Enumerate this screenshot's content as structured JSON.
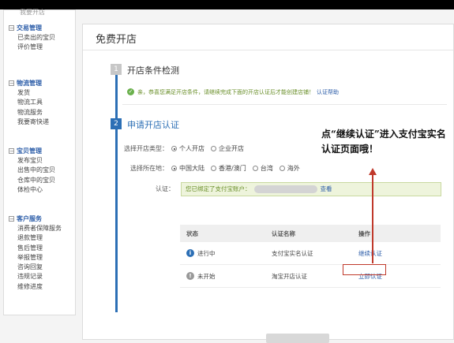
{
  "sidebar": {
    "cut_item": "我要开店",
    "sections": [
      {
        "title": "交易管理",
        "items": [
          "已卖出的宝贝",
          "评价管理"
        ]
      },
      {
        "title": "物流管理",
        "items": [
          "发货",
          "物流工具",
          "物流服务",
          "我要寄快递"
        ]
      },
      {
        "title": "宝贝管理",
        "items": [
          "发布宝贝",
          "出售中的宝贝",
          "仓库中的宝贝",
          "体检中心"
        ]
      },
      {
        "title": "客户服务",
        "items": [
          "消费者保障服务",
          "退款管理",
          "售后管理",
          "举报管理",
          "咨询回复",
          "违规记录",
          "维修进度"
        ]
      }
    ]
  },
  "main": {
    "title": "免费开店",
    "step1": {
      "number": "1",
      "title": "开店条件检测",
      "message": "亲，恭喜您满足开店条件，请继续完成下面的开店认证后才能创建店铺！",
      "link": "认证帮助"
    },
    "step2": {
      "number": "2",
      "title": "申请开店认证",
      "shop_type_label": "选择开店类型：",
      "shop_types": [
        "个人开店",
        "企业开店"
      ],
      "location_label": "选择所在地：",
      "locations": [
        "中国大陆",
        "香港/澳门",
        "台湾",
        "海外"
      ],
      "auth_label": "认证：",
      "auth_notice": "您已绑定了支付宝账户：",
      "auth_view": "查看"
    },
    "table": {
      "headers": [
        "状态",
        "认证名称",
        "操作"
      ],
      "rows": [
        {
          "status": "进行中",
          "name": "支付宝实名认证",
          "action": "继续认证"
        },
        {
          "status": "未开始",
          "name": "淘宝开店认证",
          "action": "立即认证"
        }
      ]
    }
  },
  "annotation": "点“继续认证”进入支付宝实名认证页面哦！",
  "colors": {
    "accent": "#2c6fb5",
    "highlight": "#c0392b",
    "success": "#6ab04c"
  }
}
